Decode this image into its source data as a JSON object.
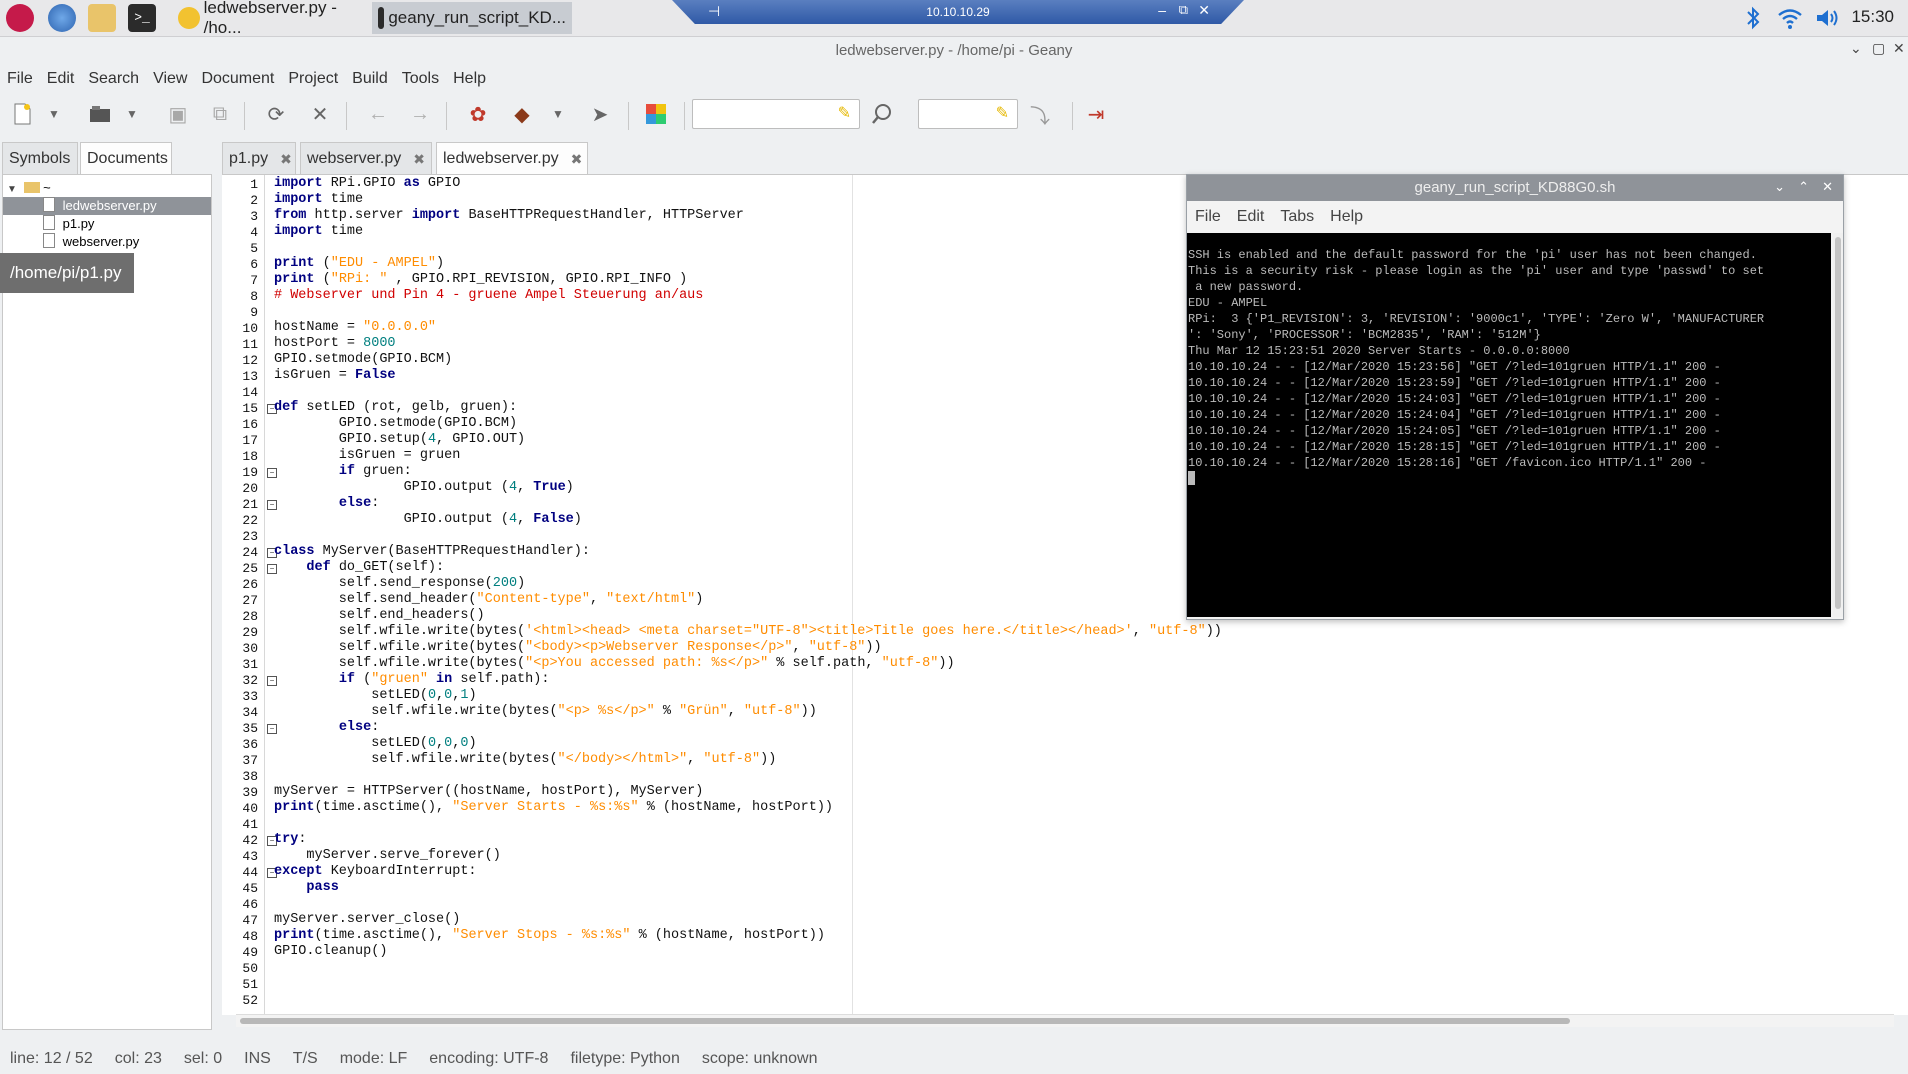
{
  "taskbar": {
    "tasks": [
      {
        "label": "ledwebserver.py - /ho..."
      },
      {
        "label": "geany_run_script_KD..."
      }
    ],
    "vnc_title": "10.10.10.29",
    "clock": "15:30"
  },
  "window": {
    "title": "ledwebserver.py - /home/pi - Geany"
  },
  "menubar": [
    "File",
    "Edit",
    "Search",
    "View",
    "Document",
    "Project",
    "Build",
    "Tools",
    "Help"
  ],
  "sidebar": {
    "tabs": [
      "Symbols",
      "Documents"
    ],
    "tree": {
      "root": "~",
      "items": [
        "ledwebserver.py",
        "p1.py",
        "webserver.py"
      ]
    },
    "tooltip": "/home/pi/p1.py"
  },
  "doc_tabs": [
    "p1.py",
    "webserver.py",
    "ledwebserver.py"
  ],
  "editor": {
    "line_count": 52,
    "lines": [
      "import RPi.GPIO as GPIO",
      "import time",
      "from http.server import BaseHTTPRequestHandler, HTTPServer",
      "import time",
      "",
      "print (\"EDU - AMPEL\")",
      "print (\"RPi: \" , GPIO.RPI_REVISION, GPIO.RPI_INFO )",
      "# Webserver und Pin 4 - gruene Ampel Steuerung an/aus",
      "",
      "hostName = \"0.0.0.0\"",
      "hostPort = 8000",
      "GPIO.setmode(GPIO.BCM)",
      "isGruen = False",
      "",
      "def setLED (rot, gelb, gruen):",
      "        GPIO.setmode(GPIO.BCM)",
      "        GPIO.setup(4, GPIO.OUT)",
      "        isGruen = gruen",
      "        if gruen:",
      "                GPIO.output (4, True)",
      "        else:",
      "                GPIO.output (4, False)",
      "",
      "class MyServer(BaseHTTPRequestHandler):",
      "    def do_GET(self):",
      "        self.send_response(200)",
      "        self.send_header(\"Content-type\", \"text/html\")",
      "        self.end_headers()",
      "        self.wfile.write(bytes('<html><head> <meta charset=\"UTF-8\"><title>Title goes here.</title></head>', \"utf-8\"))",
      "        self.wfile.write(bytes(\"<body><p>Webserver Response</p>\", \"utf-8\"))",
      "        self.wfile.write(bytes(\"<p>You accessed path: %s</p>\" % self.path, \"utf-8\"))",
      "        if (\"gruen\" in self.path):",
      "            setLED(0,0,1)",
      "            self.wfile.write(bytes(\"<p> %s</p>\" % \"Grün\", \"utf-8\"))",
      "        else:",
      "            setLED(0,0,0)",
      "            self.wfile.write(bytes(\"</body></html>\", \"utf-8\"))",
      "",
      "myServer = HTTPServer((hostName, hostPort), MyServer)",
      "print(time.asctime(), \"Server Starts - %s:%s\" % (hostName, hostPort))",
      "",
      "try:",
      "    myServer.serve_forever()",
      "except KeyboardInterrupt:",
      "    pass",
      "",
      "myServer.server_close()",
      "print(time.asctime(), \"Server Stops - %s:%s\" % (hostName, hostPort))",
      "GPIO.cleanup()",
      "",
      "",
      ""
    ]
  },
  "terminal": {
    "title": "geany_run_script_KD88G0.sh",
    "menu": [
      "File",
      "Edit",
      "Tabs",
      "Help"
    ],
    "output": [
      "SSH is enabled and the default password for the 'pi' user has not been changed.",
      "This is a security risk - please login as the 'pi' user and type 'passwd' to set",
      " a new password.",
      "",
      "EDU - AMPEL",
      "RPi:  3 {'P1_REVISION': 3, 'REVISION': '9000c1', 'TYPE': 'Zero W', 'MANUFACTURER",
      "': 'Sony', 'PROCESSOR': 'BCM2835', 'RAM': '512M'}",
      "Thu Mar 12 15:23:51 2020 Server Starts - 0.0.0.0:8000",
      "10.10.10.24 - - [12/Mar/2020 15:23:56] \"GET /?led=101gruen HTTP/1.1\" 200 -",
      "10.10.10.24 - - [12/Mar/2020 15:23:59] \"GET /?led=101gruen HTTP/1.1\" 200 -",
      "10.10.10.24 - - [12/Mar/2020 15:24:03] \"GET /?led=101gruen HTTP/1.1\" 200 -",
      "10.10.10.24 - - [12/Mar/2020 15:24:04] \"GET /?led=101gruen HTTP/1.1\" 200 -",
      "10.10.10.24 - - [12/Mar/2020 15:24:05] \"GET /?led=101gruen HTTP/1.1\" 200 -",
      "10.10.10.24 - - [12/Mar/2020 15:28:15] \"GET /?led=101gruen HTTP/1.1\" 200 -",
      "10.10.10.24 - - [12/Mar/2020 15:28:16] \"GET /favicon.ico HTTP/1.1\" 200 -"
    ]
  },
  "statusbar": {
    "line": "line: 12 / 52",
    "col": "col: 23",
    "sel": "sel: 0",
    "ins": "INS",
    "ts": "T/S",
    "mode": "mode: LF",
    "encoding": "encoding: UTF-8",
    "filetype": "filetype: Python",
    "scope": "scope: unknown"
  },
  "icons": {
    "taskbar": [
      "raspberry-menu-icon",
      "web-browser-icon",
      "file-manager-icon",
      "terminal-icon"
    ],
    "tray": [
      "bluetooth-icon",
      "wifi-icon",
      "volume-icon"
    ]
  },
  "colors": {
    "keyword": "#000080",
    "string": "#ff8c00",
    "comment": "#d00000",
    "terminal_bg": "#000000",
    "terminal_fg": "#bbbbbb"
  }
}
